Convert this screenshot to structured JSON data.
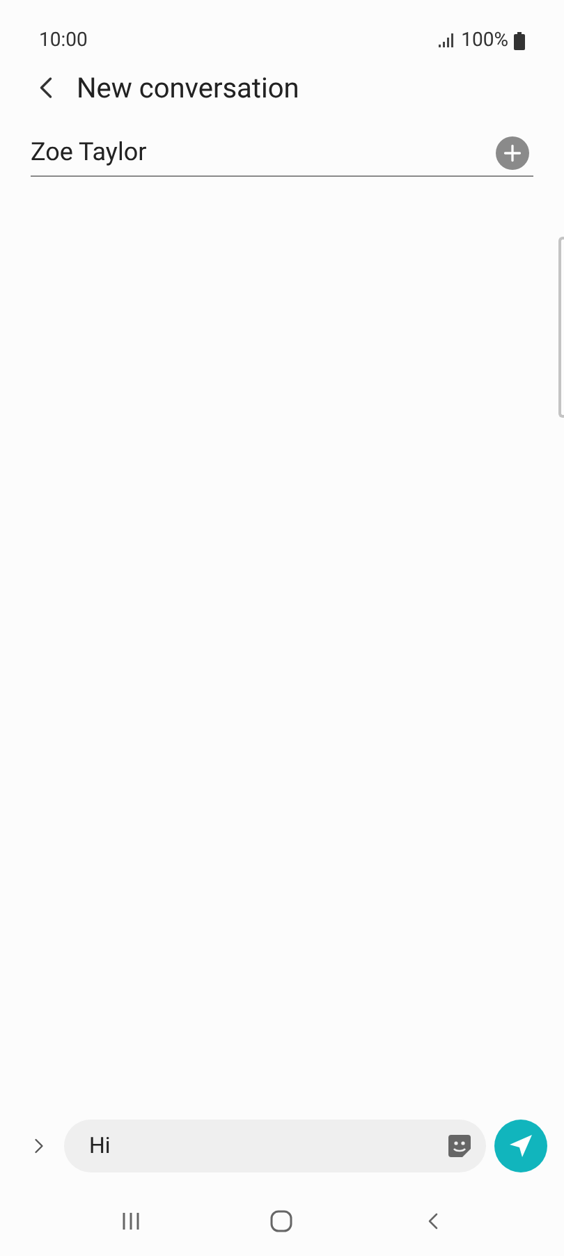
{
  "status_bar": {
    "time": "10:00",
    "battery": "100%"
  },
  "header": {
    "title": "New conversation"
  },
  "recipient": {
    "value": "Zoe Taylor"
  },
  "composer": {
    "value": "Hi"
  }
}
